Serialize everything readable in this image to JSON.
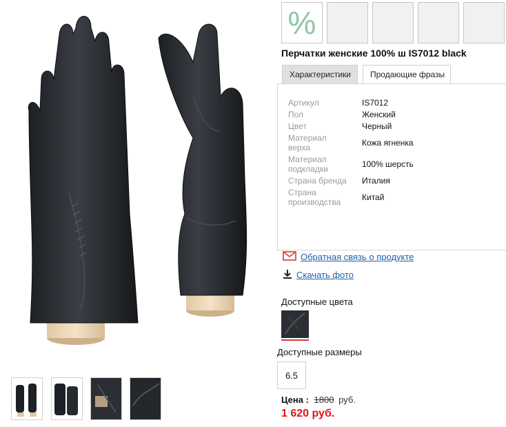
{
  "promo": {
    "percent_symbol": "%"
  },
  "product": {
    "title": "Перчатки женские 100% ш IS7012 black"
  },
  "tabs": [
    {
      "label": "Характеристики",
      "active": true
    },
    {
      "label": "Продающие фразы",
      "active": false
    }
  ],
  "characteristics": [
    {
      "label": "Артикул",
      "value": "IS7012"
    },
    {
      "label": "Пол",
      "value": "Женский"
    },
    {
      "label": "Цвет",
      "value": "Черный"
    },
    {
      "label": "Материал верха",
      "value": "Кожа ягненка"
    },
    {
      "label": "Материал подкладки",
      "value": "100% шерсть"
    },
    {
      "label": "Страна бренда",
      "value": "Италия"
    },
    {
      "label": "Страна производства",
      "value": "Китай"
    }
  ],
  "links": {
    "feedback": "Обратная связь о продукте",
    "download": "Скачать фото"
  },
  "colors": {
    "label": "Доступные цвета"
  },
  "sizes": {
    "label": "Доступные размеры",
    "items": [
      "6.5"
    ]
  },
  "price": {
    "label": "Цена :",
    "old_value": "1800",
    "old_currency": "руб.",
    "new_price": "1 620 руб."
  },
  "icons": {
    "feedback": "envelope-icon",
    "download": "download-icon"
  },
  "colors_palette": {
    "accent_red": "#e11414",
    "link_blue": "#1f5fa8",
    "promo_green": "#8fc6a6"
  }
}
